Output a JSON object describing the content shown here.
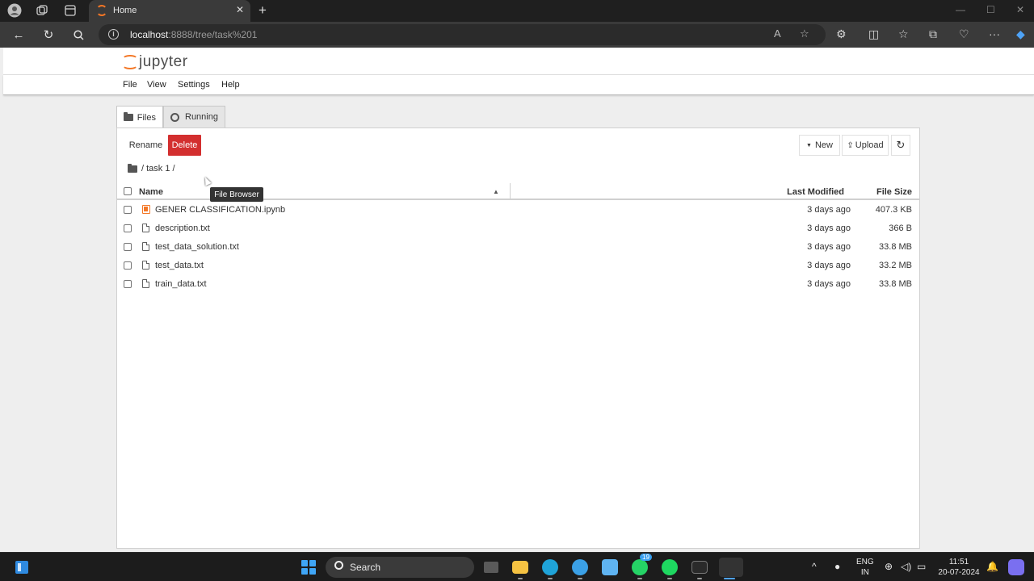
{
  "browser": {
    "tab_title": "Home",
    "url_host": "localhost",
    "url_rest": ":8888/tree/task%201"
  },
  "jupyter": {
    "logo_text": "jupyter",
    "menu": [
      "File",
      "View",
      "Settings",
      "Help"
    ],
    "tabs": [
      {
        "label": "Files",
        "icon": "folder-icon",
        "active": true
      },
      {
        "label": "Running",
        "icon": "running-icon",
        "active": false
      }
    ],
    "toolbar": {
      "rename_label": "Rename",
      "delete_label": "Delete",
      "new_label": "New",
      "upload_label": "Upload"
    },
    "breadcrumb": "/ task 1 /",
    "tooltip": "File Browser",
    "columns": {
      "name": "Name",
      "modified": "Last Modified",
      "size": "File Size"
    },
    "files": [
      {
        "name": "GENER CLASSIFICATION.ipynb",
        "modified": "3 days ago",
        "size": "407.3 KB",
        "type": "notebook"
      },
      {
        "name": "description.txt",
        "modified": "3 days ago",
        "size": "366 B",
        "type": "file"
      },
      {
        "name": "test_data_solution.txt",
        "modified": "3 days ago",
        "size": "33.8 MB",
        "type": "file"
      },
      {
        "name": "test_data.txt",
        "modified": "3 days ago",
        "size": "33.2 MB",
        "type": "file"
      },
      {
        "name": "train_data.txt",
        "modified": "3 days ago",
        "size": "33.8 MB",
        "type": "file"
      }
    ]
  },
  "taskbar": {
    "search_label": "Search",
    "lang_top": "ENG",
    "lang_bottom": "IN",
    "time": "11:51",
    "date": "20-07-2024",
    "whatsapp_badge": "19"
  },
  "colors": {
    "jupyter_orange": "#f37726",
    "delete_red": "#d32f2f",
    "windows_blue": "#3fa5f5"
  }
}
